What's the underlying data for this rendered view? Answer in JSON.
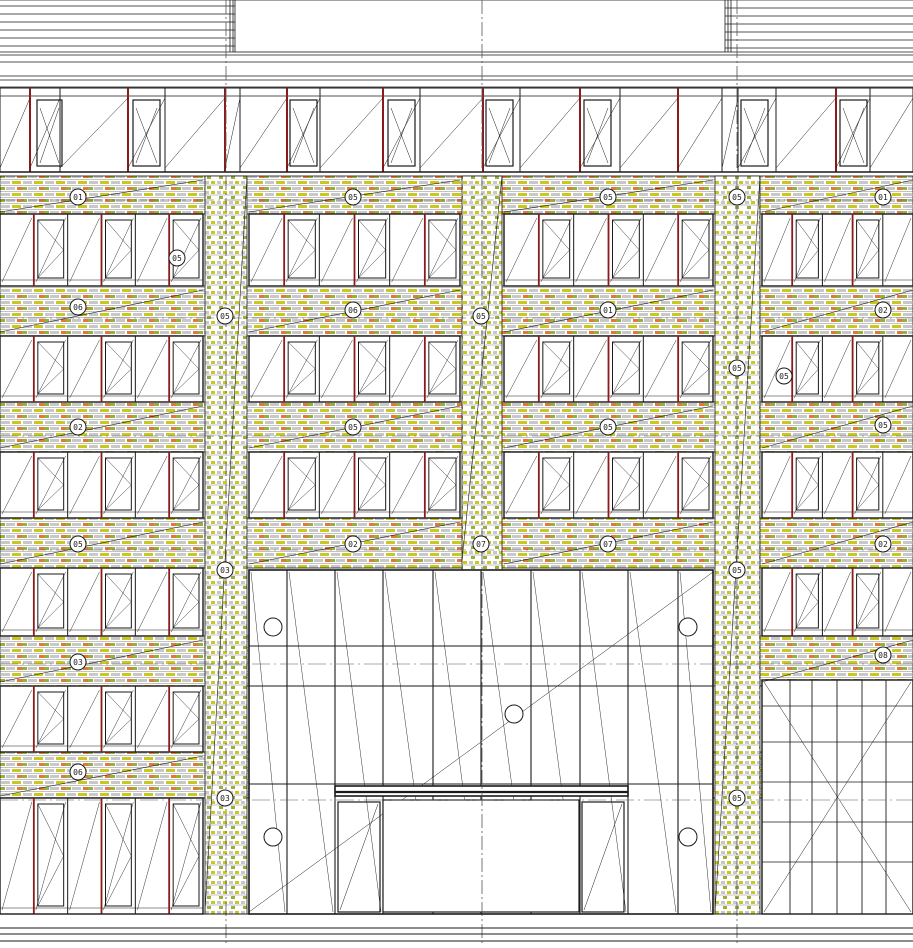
{
  "drawing": {
    "kind": "architectural facade elevation",
    "colors": {
      "line": "#1a1a1a",
      "brick_yellow": "#c8c81e",
      "brick_green": "#9aae3c",
      "brick_orange": "#e07a3a",
      "brick_grey": "#9a9a9a",
      "window_frame_red": "#8b1a1a",
      "axis": "#555555"
    },
    "tags": [
      {
        "id": "tag-1",
        "text": "01"
      },
      {
        "id": "tag-2",
        "text": "05"
      },
      {
        "id": "tag-3",
        "text": "05"
      },
      {
        "id": "tag-4",
        "text": "05"
      },
      {
        "id": "tag-5",
        "text": "01"
      },
      {
        "id": "tag-6",
        "text": "05"
      },
      {
        "id": "tag-7",
        "text": "06"
      },
      {
        "id": "tag-8",
        "text": "05"
      },
      {
        "id": "tag-9",
        "text": "06"
      },
      {
        "id": "tag-10",
        "text": "05"
      },
      {
        "id": "tag-11",
        "text": "01"
      },
      {
        "id": "tag-12",
        "text": "02"
      },
      {
        "id": "tag-13",
        "text": "05"
      },
      {
        "id": "tag-14",
        "text": "05"
      },
      {
        "id": "tag-15",
        "text": "02"
      },
      {
        "id": "tag-16",
        "text": "05"
      },
      {
        "id": "tag-17",
        "text": "05"
      },
      {
        "id": "tag-18",
        "text": "05"
      },
      {
        "id": "tag-19",
        "text": "05"
      },
      {
        "id": "tag-20",
        "text": "02"
      },
      {
        "id": "tag-21",
        "text": "07"
      },
      {
        "id": "tag-22",
        "text": "07"
      },
      {
        "id": "tag-23",
        "text": "02"
      },
      {
        "id": "tag-24",
        "text": "03"
      },
      {
        "id": "tag-25",
        "text": "05"
      },
      {
        "id": "tag-26",
        "text": "03"
      },
      {
        "id": "tag-27",
        "text": "08"
      },
      {
        "id": "tag-28",
        "text": "06"
      },
      {
        "id": "tag-29",
        "text": "03"
      },
      {
        "id": "tag-30",
        "text": "05"
      }
    ]
  }
}
